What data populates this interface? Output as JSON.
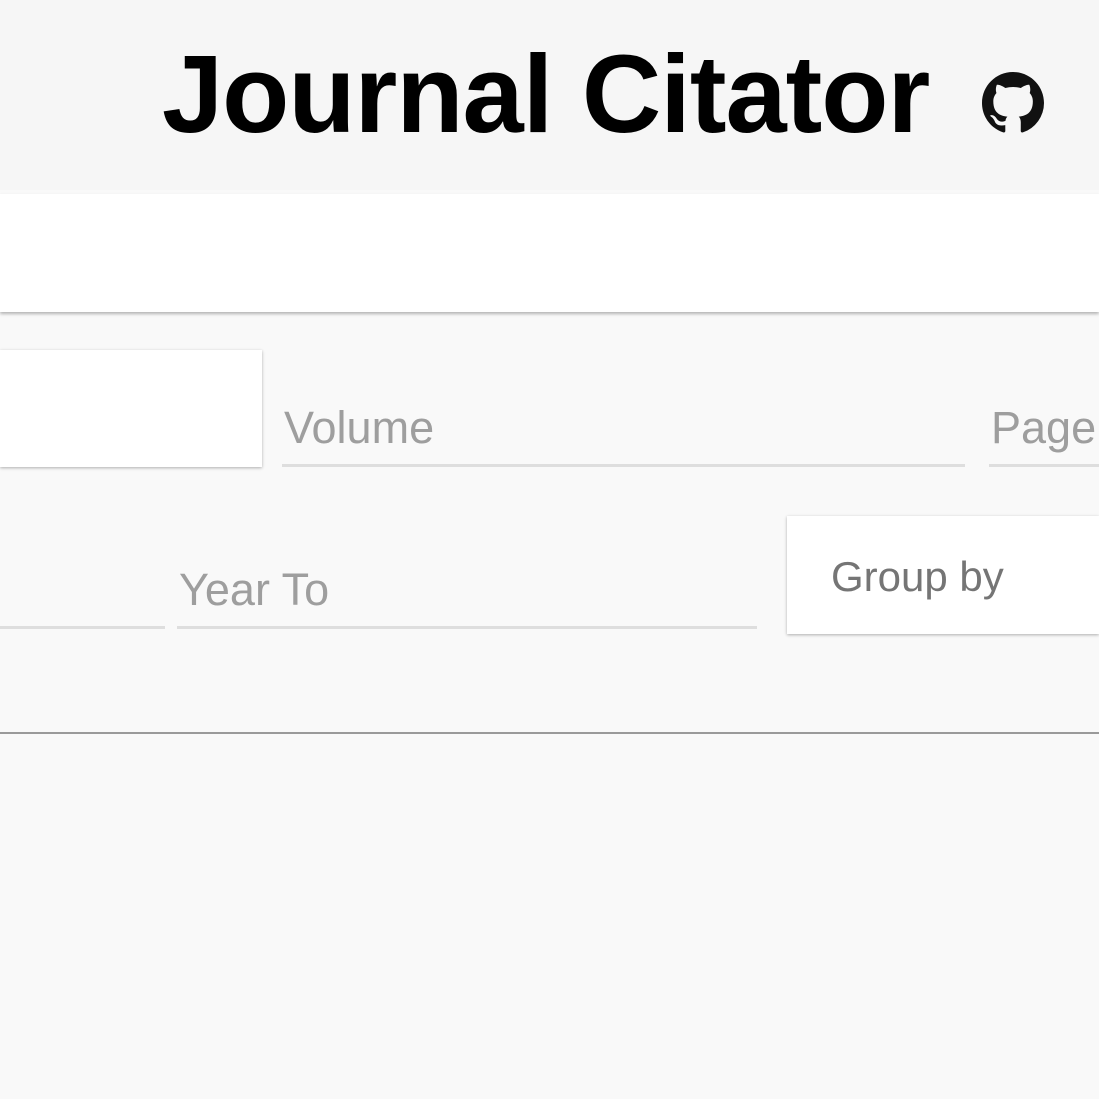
{
  "header": {
    "title": "Journal Citator",
    "github_link_icon": "github-icon"
  },
  "search": {
    "query_value": ""
  },
  "form": {
    "journal_value": "",
    "volume_placeholder": "Volume",
    "page_placeholder": "Page",
    "year_from_placeholder": "",
    "year_to_placeholder": "Year To",
    "group_by_label": "Group by"
  },
  "colors": {
    "background": "#f9f9f9",
    "title": "#000000",
    "placeholder": "#9e9e9e",
    "underline": "#dedede"
  }
}
